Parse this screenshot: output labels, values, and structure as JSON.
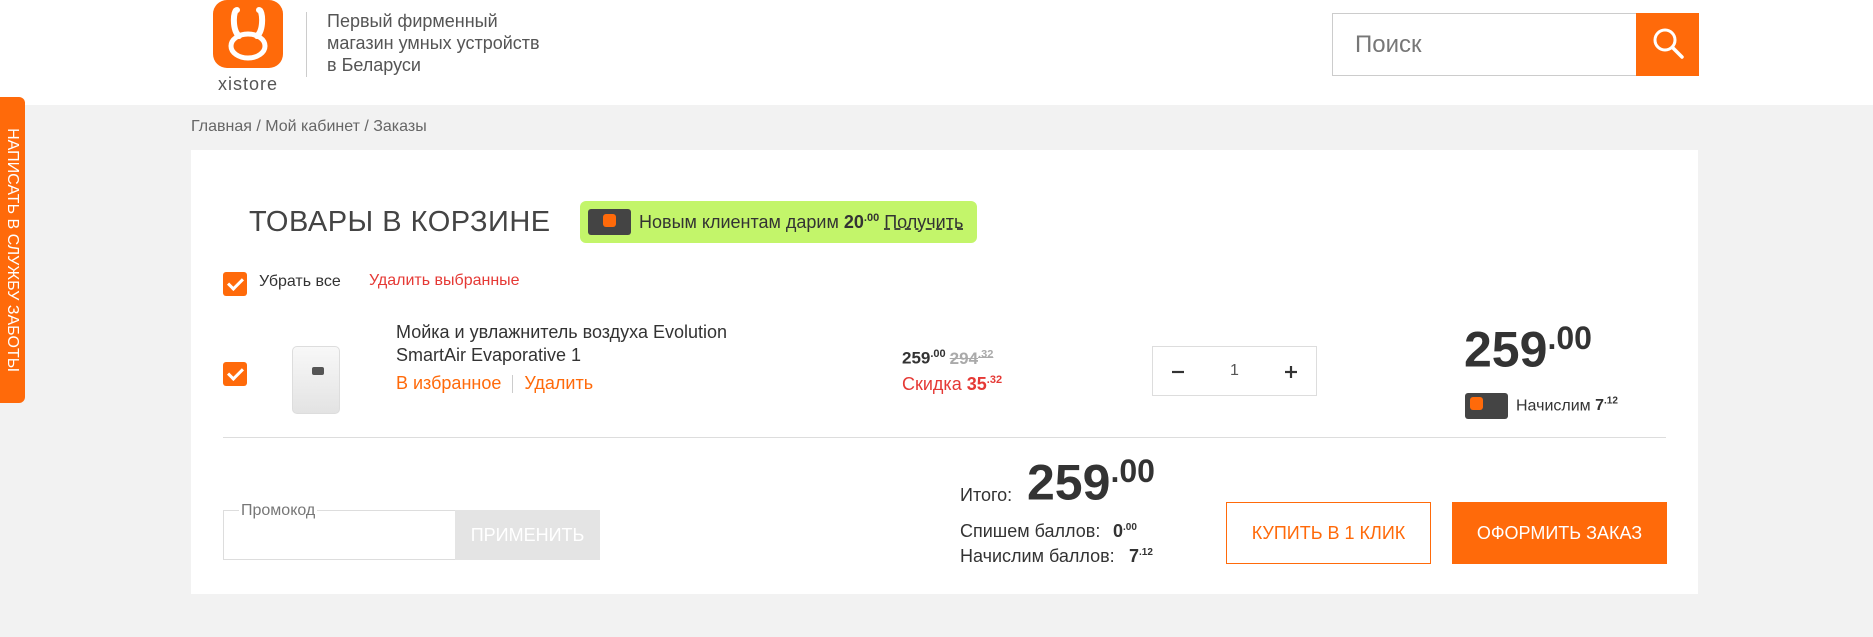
{
  "header": {
    "logo_text": "xistore",
    "tagline": "Первый фирменный магазин умных устройств в Беларуси",
    "search_placeholder": "Поиск"
  },
  "side_tab": {
    "label": "НАПИСАТЬ В СЛУЖБУ ЗАБОТЫ"
  },
  "breadcrumb": "Главная / Мой кабинет / Заказы",
  "cart": {
    "title": "ТОВАРЫ В КОРЗИНЕ",
    "promo_banner": {
      "text": "Новым клиентам дарим",
      "amount_main": "20",
      "amount_cents": ".00",
      "link": "Получить"
    },
    "select_all_label": "Убрать все",
    "delete_selected": "Удалить выбранные",
    "item": {
      "name": "Мойка и увлажнитель воздуха Evolution SmartAir Evaporative 1",
      "favorite": "В избранное",
      "delete": "Удалить",
      "price_main": "259",
      "price_cents": ".00",
      "old_price_main": "294",
      "old_price_cents": ".32",
      "discount_label": "Скидка",
      "discount_main": "35",
      "discount_cents": ".32",
      "quantity": "1",
      "total_main": "259",
      "total_cents": ".00",
      "bonus_label": "Начислим",
      "bonus_main": "7",
      "bonus_cents": ".12"
    },
    "promo_code": {
      "legend": "Промокод",
      "value": "",
      "apply": "ПРИМЕНИТЬ"
    },
    "summary": {
      "total_label": "Итого:",
      "total_main": "259",
      "total_cents": ".00",
      "write_off_label": "Спишем баллов:",
      "write_off_main": "0",
      "write_off_cents": ".00",
      "accrue_label": "Начислим баллов:",
      "accrue_main": "7",
      "accrue_cents": ".12"
    },
    "buttons": {
      "buy_one_click": "КУПИТЬ В 1 КЛИК",
      "checkout": "ОФОРМИТЬ ЗАКАЗ"
    }
  },
  "colors": {
    "accent": "#ff6a0a",
    "danger": "#e53935",
    "promo_bg": "#c3f56a"
  },
  "icons": [
    "search-icon",
    "minus-icon",
    "plus-icon",
    "checkbox-icon",
    "bonus-card-icon"
  ]
}
